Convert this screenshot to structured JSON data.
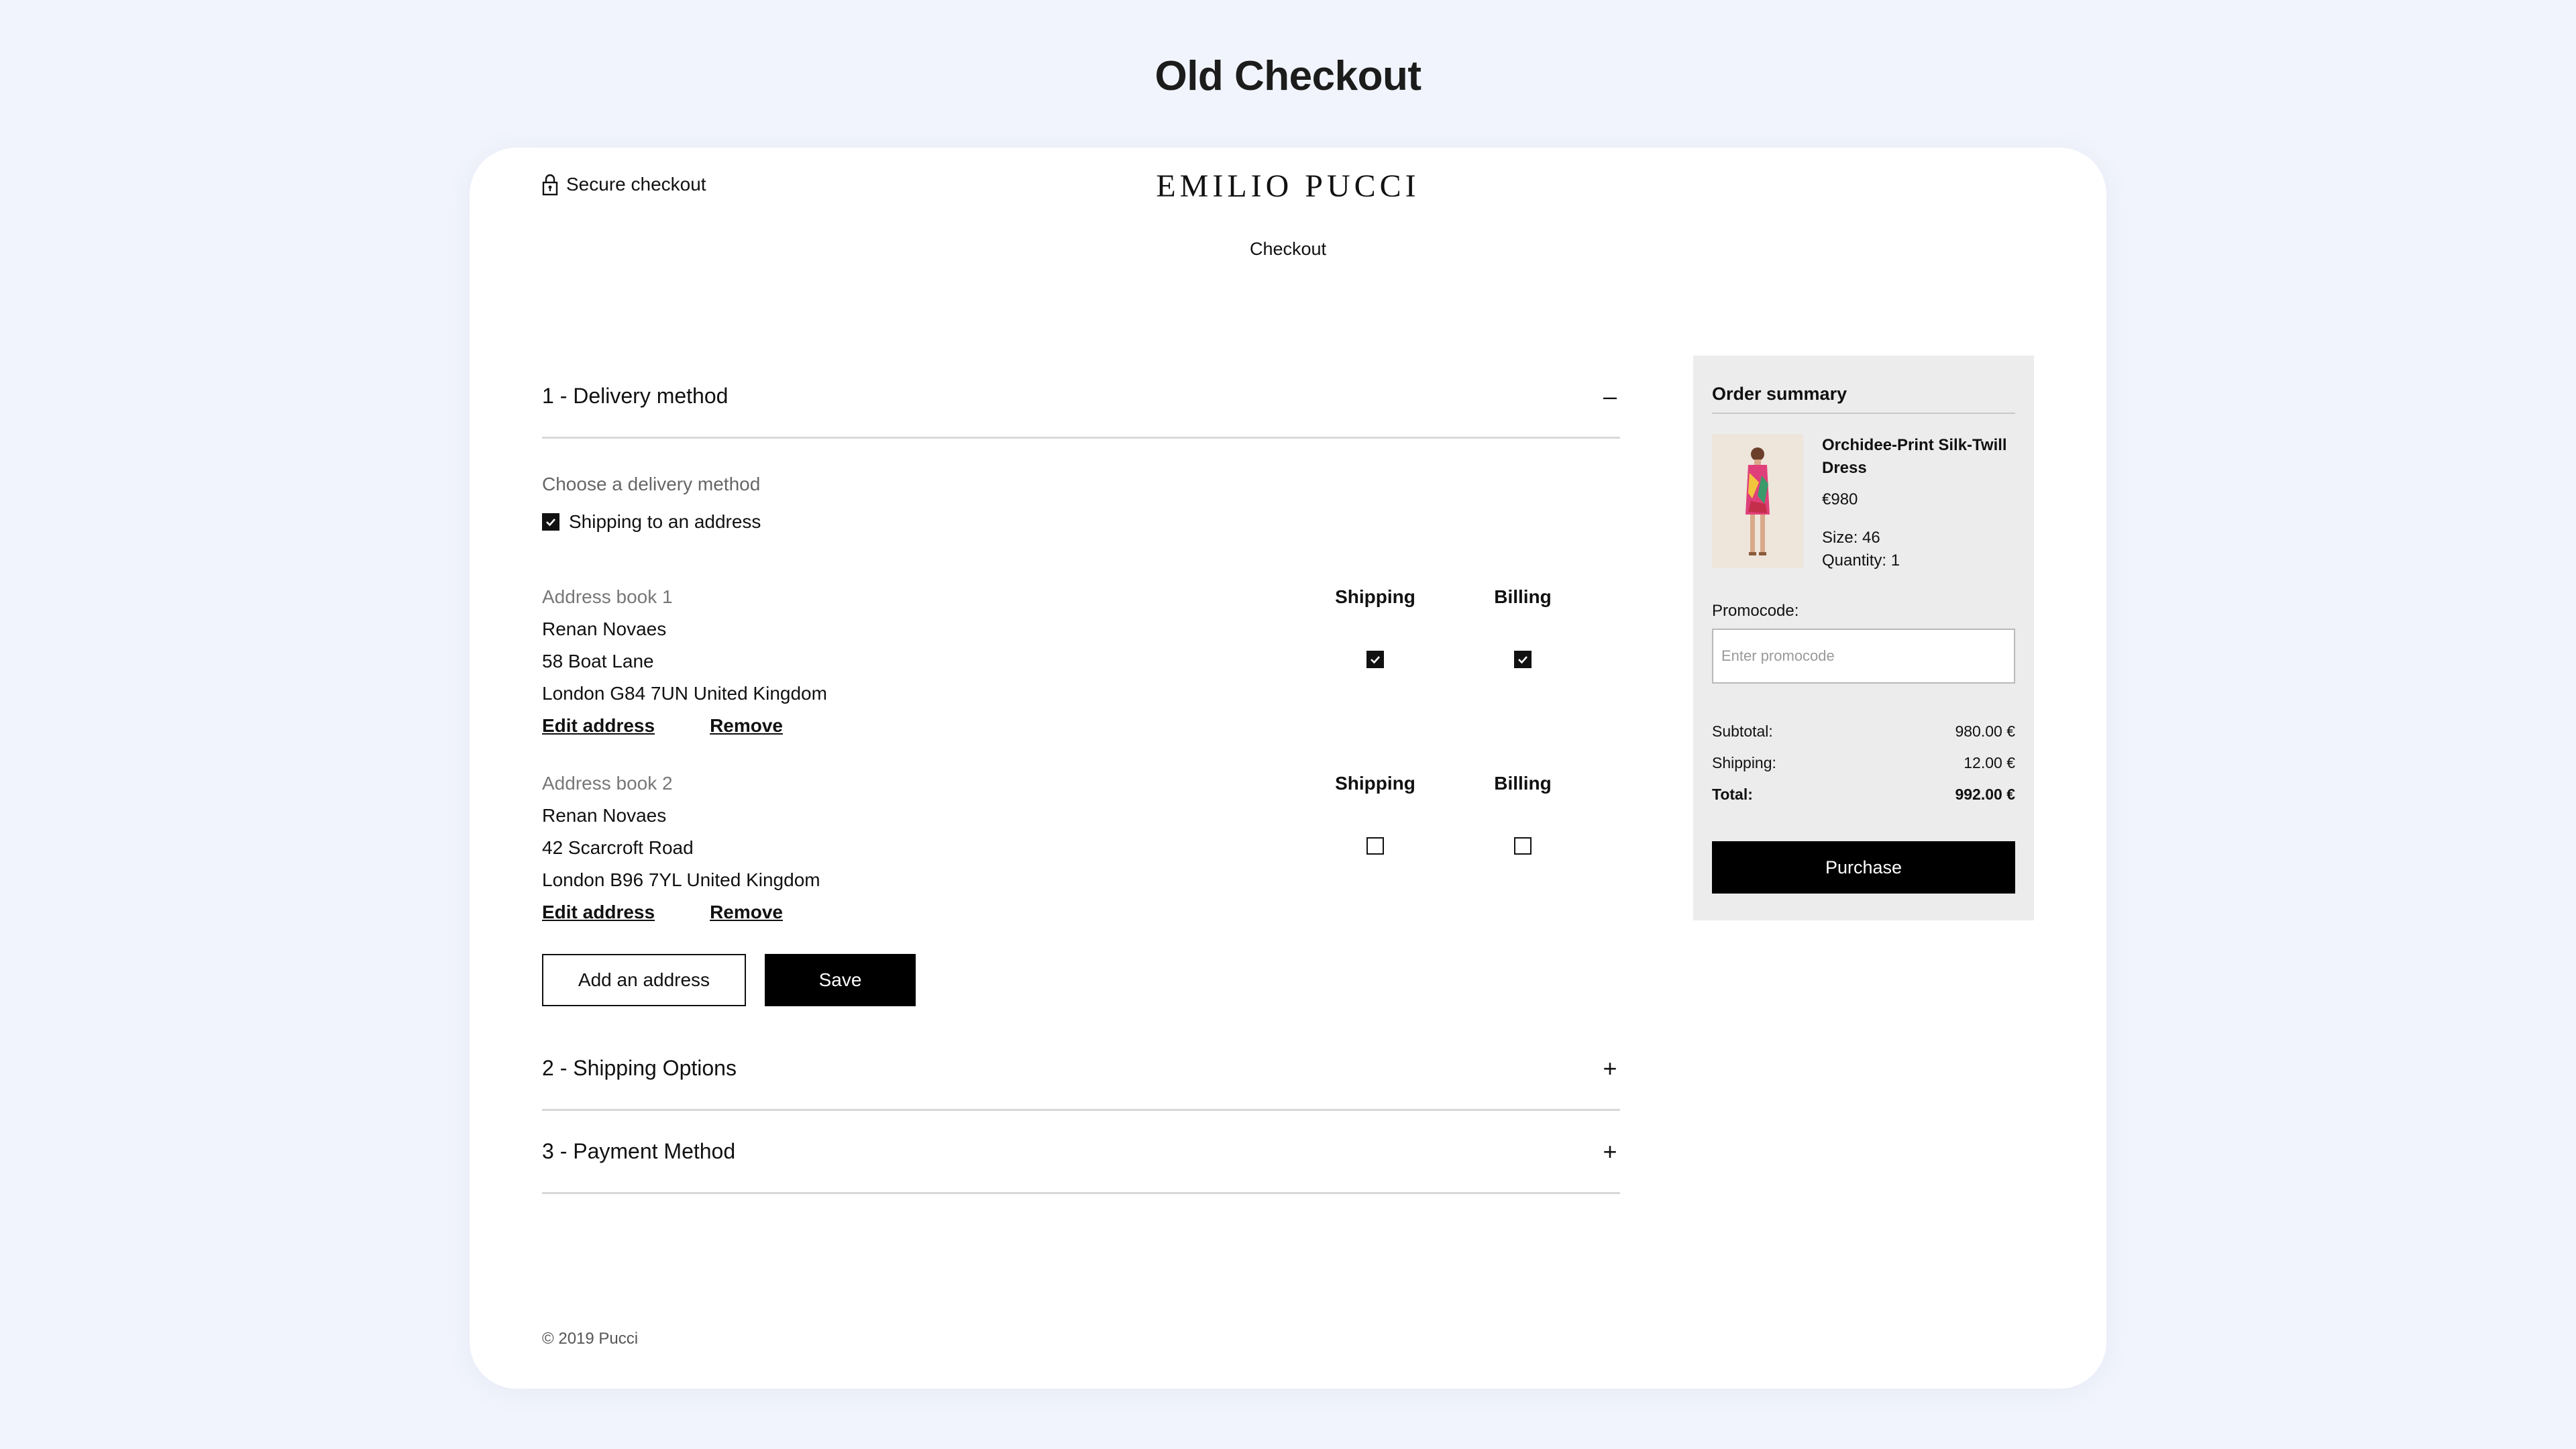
{
  "page_heading": "Old Checkout",
  "header": {
    "secure_label": "Secure checkout",
    "brand": "EMILIO PUCCI",
    "subtitle": "Checkout"
  },
  "delivery": {
    "title": "1 - Delivery method",
    "toggle": "–",
    "choose_label": "Choose a delivery method",
    "shipping_option": "Shipping to an address",
    "shipping_option_checked": true,
    "col_shipping": "Shipping",
    "col_billing": "Billing",
    "addresses": [
      {
        "title": "Address book 1",
        "name": "Renan Novaes",
        "street": "58 Boat Lane",
        "city": "London G84 7UN United Kingdom",
        "shipping_checked": true,
        "billing_checked": true
      },
      {
        "title": "Address book 2",
        "name": "Renan Novaes",
        "street": "42 Scarcroft Road",
        "city": "London  B96 7YL United Kingdom",
        "shipping_checked": false,
        "billing_checked": false
      }
    ],
    "edit_label": "Edit address",
    "remove_label": "Remove",
    "add_address_label": "Add an address",
    "save_label": "Save"
  },
  "sections": [
    {
      "title": "2 - Shipping Options",
      "toggle": "+"
    },
    {
      "title": "3 - Payment Method",
      "toggle": "+"
    }
  ],
  "footer": "© 2019 Pucci",
  "summary": {
    "title": "Order summary",
    "product_name": "Orchidee-Print Silk-Twill Dress",
    "price": "€980",
    "size": "Size: 46",
    "quantity": "Quantity: 1",
    "promo_label": "Promocode:",
    "promo_placeholder": "Enter promocode",
    "subtotal_label": "Subtotal:",
    "subtotal_value": "980.00 €",
    "shipping_label": "Shipping:",
    "shipping_value": "12.00 €",
    "total_label": "Total:",
    "total_value": "992.00 €",
    "purchase_label": "Purchase"
  }
}
